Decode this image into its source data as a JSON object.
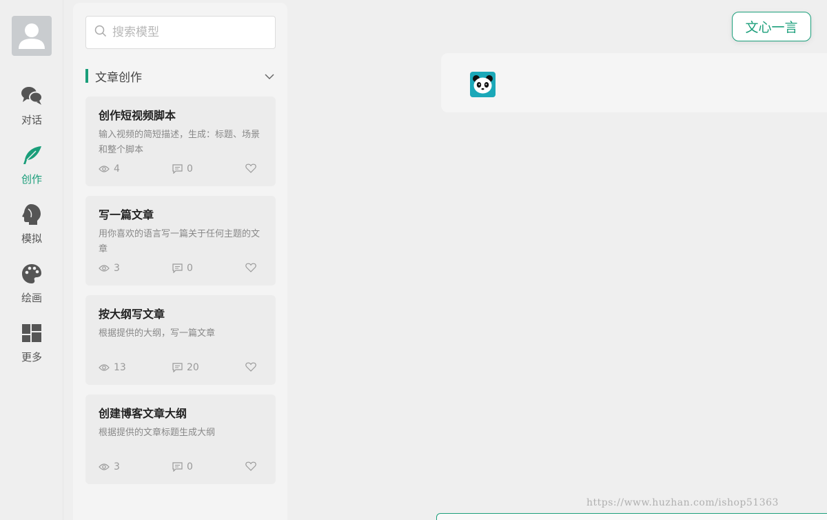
{
  "nav": {
    "items": [
      {
        "label": "对话",
        "icon": "chat-bubbles-icon"
      },
      {
        "label": "创作",
        "icon": "feather-icon",
        "active": true
      },
      {
        "label": "模拟",
        "icon": "head-profile-icon"
      },
      {
        "label": "绘画",
        "icon": "palette-icon"
      },
      {
        "label": "更多",
        "icon": "grid-icon"
      }
    ]
  },
  "search": {
    "placeholder": "搜索模型",
    "value": ""
  },
  "section": {
    "title": "文章创作"
  },
  "cards": [
    {
      "title": "创作短视频脚本",
      "desc": "输入视频的简短描述，生成：标题、场景和整个脚本",
      "views": "4",
      "comments": "0"
    },
    {
      "title": "写一篇文章",
      "desc": "用你喜欢的语言写一篇关于任何主题的文章",
      "views": "3",
      "comments": "0"
    },
    {
      "title": "按大纲写文章",
      "desc": "根据提供的大纲，写一篇文章",
      "views": "13",
      "comments": "20"
    },
    {
      "title": "创建博客文章大纲",
      "desc": "根据提供的文章标题生成大纲",
      "views": "3",
      "comments": "0"
    }
  ],
  "header": {
    "model_button": "文心一言"
  },
  "watermark": "https://www.huzhan.com/ishop51363",
  "colors": {
    "accent": "#1a9e7a",
    "background": "#efefef"
  }
}
